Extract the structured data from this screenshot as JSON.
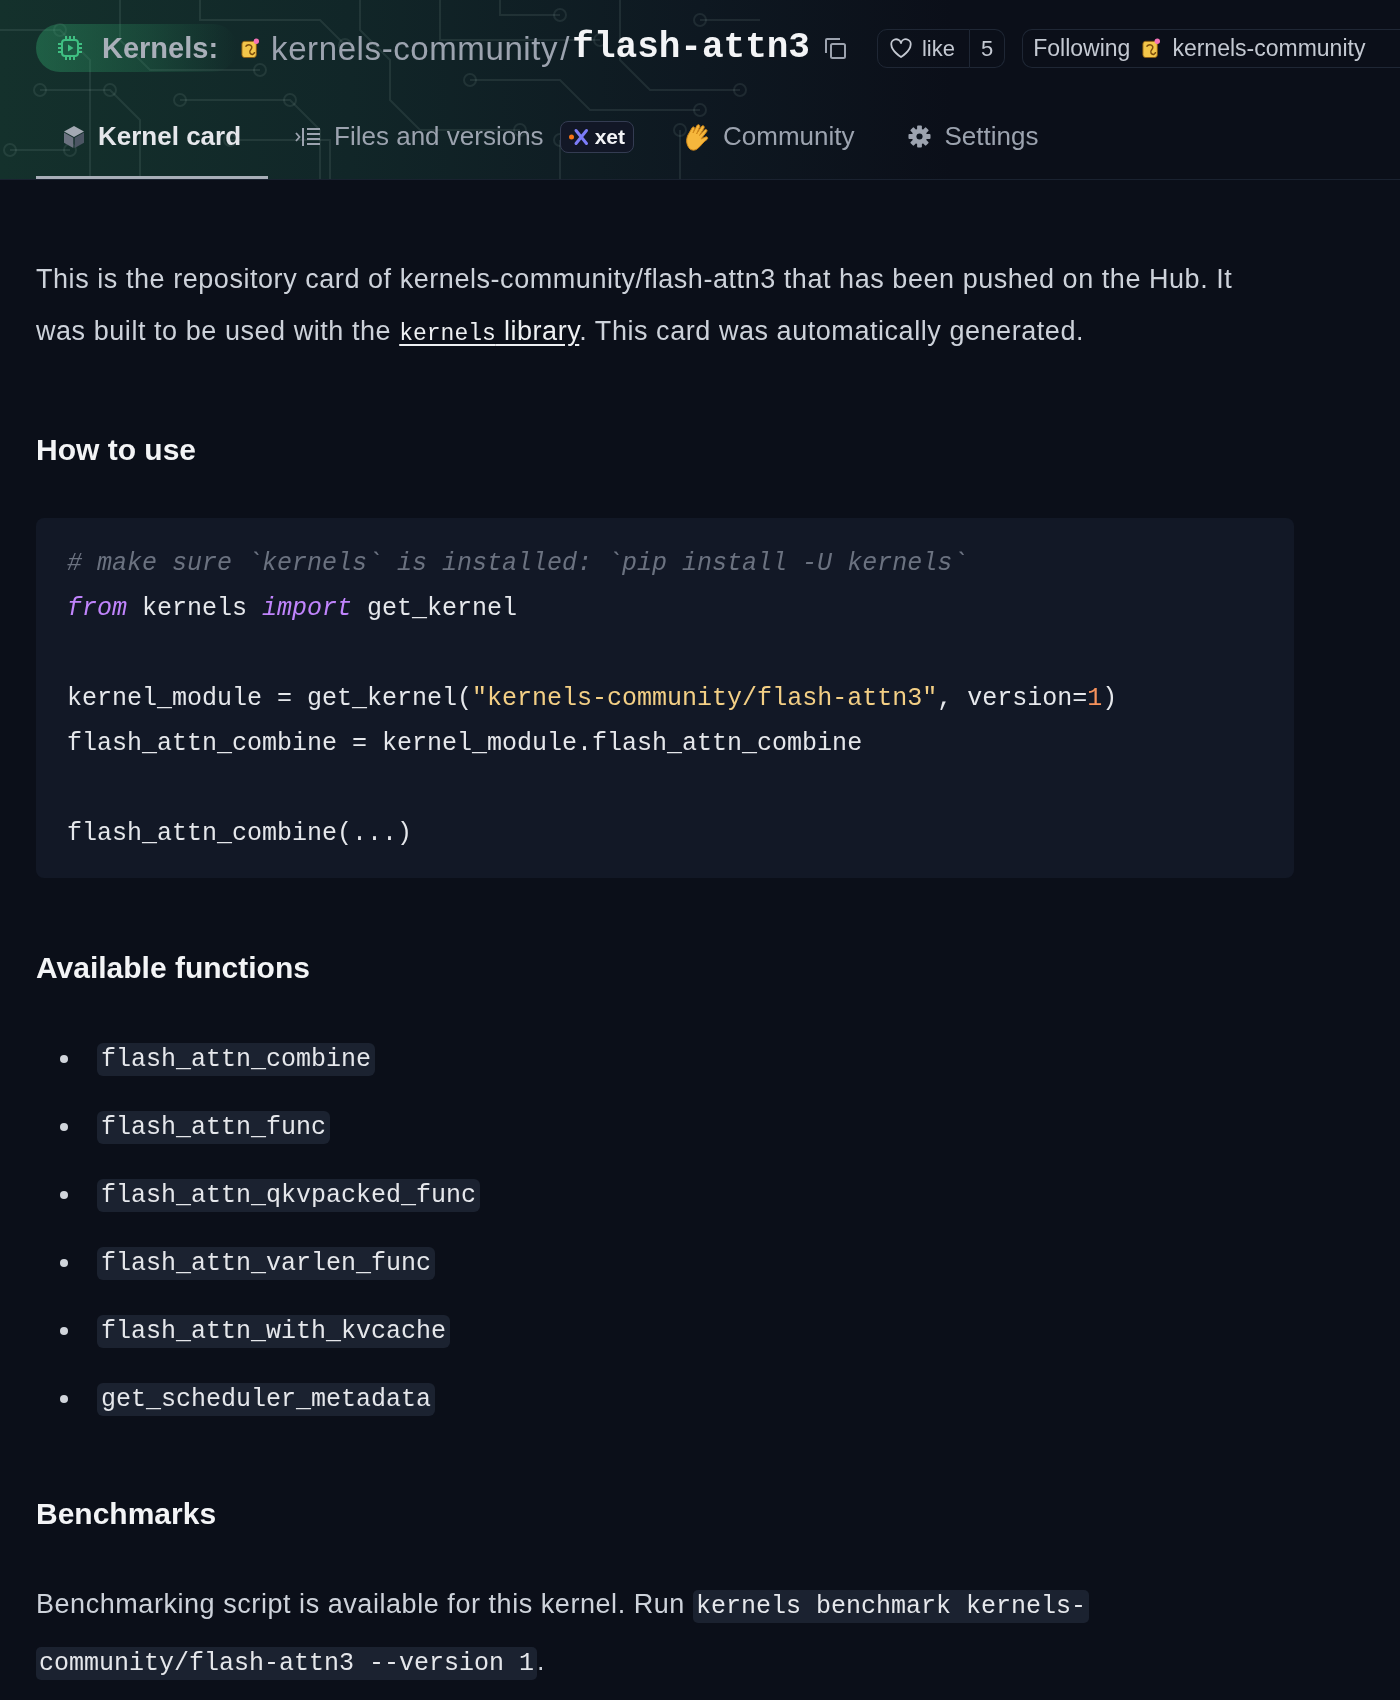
{
  "header": {
    "title": {
      "type_label": "Kernels:",
      "owner": "kernels-community",
      "separator": "/",
      "name": "flash-attn3"
    },
    "like": {
      "label": "like",
      "count": "5"
    },
    "follow": {
      "label": "Following",
      "owner": "kernels-community"
    }
  },
  "tabs": [
    {
      "label": "Kernel card",
      "kind": "card",
      "selected": true
    },
    {
      "label": "Files and versions",
      "kind": "files",
      "selected": false,
      "badge": "xet"
    },
    {
      "label": "Community",
      "kind": "community",
      "selected": false
    },
    {
      "label": "Settings",
      "kind": "settings",
      "selected": false
    }
  ],
  "intro": {
    "parts": [
      {
        "kind": "text",
        "text": "This is the repository card of kernels-community/flash-attn3 that has been pushed on the Hub. It was built to be used with the "
      },
      {
        "kind": "link",
        "code": "kernels",
        "text": " library"
      },
      {
        "kind": "text",
        "text": ". This card was automatically generated."
      }
    ]
  },
  "sections": [
    {
      "heading": "How to use",
      "kind": "code",
      "groups": [
        {
          "lines": [
            {
              "tokens": [
                {
                  "kind": "comment",
                  "text": "# make sure `kernels` is installed: `pip install -U kernels`"
                }
              ]
            },
            {
              "tokens": [
                {
                  "kind": "keyword",
                  "text": "from"
                },
                {
                  "kind": "plain",
                  "text": " kernels "
                },
                {
                  "kind": "keyword",
                  "text": "import"
                },
                {
                  "kind": "plain",
                  "text": " get_kernel"
                }
              ]
            }
          ]
        },
        {
          "lines": [
            {
              "tokens": [
                {
                  "kind": "plain",
                  "text": "kernel_module = get_kernel("
                },
                {
                  "kind": "string",
                  "text": "\"kernels-community/flash-attn3\""
                },
                {
                  "kind": "plain",
                  "text": ", version="
                },
                {
                  "kind": "number",
                  "text": "1"
                },
                {
                  "kind": "plain",
                  "text": ")"
                }
              ]
            },
            {
              "tokens": [
                {
                  "kind": "plain",
                  "text": "flash_attn_combine = kernel_module.flash_attn_combine"
                }
              ]
            }
          ]
        },
        {
          "lines": [
            {
              "tokens": [
                {
                  "kind": "plain",
                  "text": "flash_attn_combine(...)"
                }
              ]
            }
          ]
        }
      ]
    },
    {
      "heading": "Available functions",
      "kind": "list",
      "items": [
        "flash_attn_combine",
        "flash_attn_func",
        "flash_attn_qkvpacked_func",
        "flash_attn_varlen_func",
        "flash_attn_with_kvcache",
        "get_scheduler_metadata"
      ]
    },
    {
      "heading": "Benchmarks",
      "kind": "paragraph",
      "parts": [
        {
          "kind": "text",
          "text": "Benchmarking script is available for this kernel. Run "
        },
        {
          "kind": "code",
          "text": "kernels benchmark kernels-community/flash-attn3 --version 1"
        },
        {
          "kind": "text",
          "text": "."
        }
      ]
    }
  ]
}
